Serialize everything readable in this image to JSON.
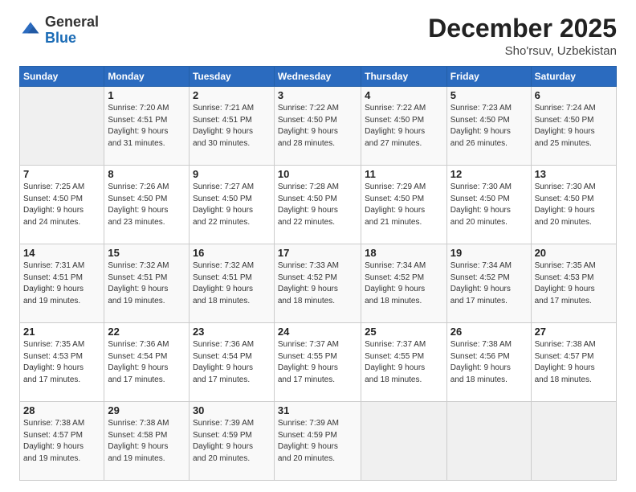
{
  "logo": {
    "general": "General",
    "blue": "Blue"
  },
  "header": {
    "month": "December 2025",
    "location": "Sho'rsuv, Uzbekistan"
  },
  "days_of_week": [
    "Sunday",
    "Monday",
    "Tuesday",
    "Wednesday",
    "Thursday",
    "Friday",
    "Saturday"
  ],
  "weeks": [
    [
      {
        "day": "",
        "sunrise": "",
        "sunset": "",
        "daylight": ""
      },
      {
        "day": "1",
        "sunrise": "Sunrise: 7:20 AM",
        "sunset": "Sunset: 4:51 PM",
        "daylight": "Daylight: 9 hours and 31 minutes."
      },
      {
        "day": "2",
        "sunrise": "Sunrise: 7:21 AM",
        "sunset": "Sunset: 4:51 PM",
        "daylight": "Daylight: 9 hours and 30 minutes."
      },
      {
        "day": "3",
        "sunrise": "Sunrise: 7:22 AM",
        "sunset": "Sunset: 4:50 PM",
        "daylight": "Daylight: 9 hours and 28 minutes."
      },
      {
        "day": "4",
        "sunrise": "Sunrise: 7:22 AM",
        "sunset": "Sunset: 4:50 PM",
        "daylight": "Daylight: 9 hours and 27 minutes."
      },
      {
        "day": "5",
        "sunrise": "Sunrise: 7:23 AM",
        "sunset": "Sunset: 4:50 PM",
        "daylight": "Daylight: 9 hours and 26 minutes."
      },
      {
        "day": "6",
        "sunrise": "Sunrise: 7:24 AM",
        "sunset": "Sunset: 4:50 PM",
        "daylight": "Daylight: 9 hours and 25 minutes."
      }
    ],
    [
      {
        "day": "7",
        "sunrise": "Sunrise: 7:25 AM",
        "sunset": "Sunset: 4:50 PM",
        "daylight": "Daylight: 9 hours and 24 minutes."
      },
      {
        "day": "8",
        "sunrise": "Sunrise: 7:26 AM",
        "sunset": "Sunset: 4:50 PM",
        "daylight": "Daylight: 9 hours and 23 minutes."
      },
      {
        "day": "9",
        "sunrise": "Sunrise: 7:27 AM",
        "sunset": "Sunset: 4:50 PM",
        "daylight": "Daylight: 9 hours and 22 minutes."
      },
      {
        "day": "10",
        "sunrise": "Sunrise: 7:28 AM",
        "sunset": "Sunset: 4:50 PM",
        "daylight": "Daylight: 9 hours and 22 minutes."
      },
      {
        "day": "11",
        "sunrise": "Sunrise: 7:29 AM",
        "sunset": "Sunset: 4:50 PM",
        "daylight": "Daylight: 9 hours and 21 minutes."
      },
      {
        "day": "12",
        "sunrise": "Sunrise: 7:30 AM",
        "sunset": "Sunset: 4:50 PM",
        "daylight": "Daylight: 9 hours and 20 minutes."
      },
      {
        "day": "13",
        "sunrise": "Sunrise: 7:30 AM",
        "sunset": "Sunset: 4:50 PM",
        "daylight": "Daylight: 9 hours and 20 minutes."
      }
    ],
    [
      {
        "day": "14",
        "sunrise": "Sunrise: 7:31 AM",
        "sunset": "Sunset: 4:51 PM",
        "daylight": "Daylight: 9 hours and 19 minutes."
      },
      {
        "day": "15",
        "sunrise": "Sunrise: 7:32 AM",
        "sunset": "Sunset: 4:51 PM",
        "daylight": "Daylight: 9 hours and 19 minutes."
      },
      {
        "day": "16",
        "sunrise": "Sunrise: 7:32 AM",
        "sunset": "Sunset: 4:51 PM",
        "daylight": "Daylight: 9 hours and 18 minutes."
      },
      {
        "day": "17",
        "sunrise": "Sunrise: 7:33 AM",
        "sunset": "Sunset: 4:52 PM",
        "daylight": "Daylight: 9 hours and 18 minutes."
      },
      {
        "day": "18",
        "sunrise": "Sunrise: 7:34 AM",
        "sunset": "Sunset: 4:52 PM",
        "daylight": "Daylight: 9 hours and 18 minutes."
      },
      {
        "day": "19",
        "sunrise": "Sunrise: 7:34 AM",
        "sunset": "Sunset: 4:52 PM",
        "daylight": "Daylight: 9 hours and 17 minutes."
      },
      {
        "day": "20",
        "sunrise": "Sunrise: 7:35 AM",
        "sunset": "Sunset: 4:53 PM",
        "daylight": "Daylight: 9 hours and 17 minutes."
      }
    ],
    [
      {
        "day": "21",
        "sunrise": "Sunrise: 7:35 AM",
        "sunset": "Sunset: 4:53 PM",
        "daylight": "Daylight: 9 hours and 17 minutes."
      },
      {
        "day": "22",
        "sunrise": "Sunrise: 7:36 AM",
        "sunset": "Sunset: 4:54 PM",
        "daylight": "Daylight: 9 hours and 17 minutes."
      },
      {
        "day": "23",
        "sunrise": "Sunrise: 7:36 AM",
        "sunset": "Sunset: 4:54 PM",
        "daylight": "Daylight: 9 hours and 17 minutes."
      },
      {
        "day": "24",
        "sunrise": "Sunrise: 7:37 AM",
        "sunset": "Sunset: 4:55 PM",
        "daylight": "Daylight: 9 hours and 17 minutes."
      },
      {
        "day": "25",
        "sunrise": "Sunrise: 7:37 AM",
        "sunset": "Sunset: 4:55 PM",
        "daylight": "Daylight: 9 hours and 18 minutes."
      },
      {
        "day": "26",
        "sunrise": "Sunrise: 7:38 AM",
        "sunset": "Sunset: 4:56 PM",
        "daylight": "Daylight: 9 hours and 18 minutes."
      },
      {
        "day": "27",
        "sunrise": "Sunrise: 7:38 AM",
        "sunset": "Sunset: 4:57 PM",
        "daylight": "Daylight: 9 hours and 18 minutes."
      }
    ],
    [
      {
        "day": "28",
        "sunrise": "Sunrise: 7:38 AM",
        "sunset": "Sunset: 4:57 PM",
        "daylight": "Daylight: 9 hours and 19 minutes."
      },
      {
        "day": "29",
        "sunrise": "Sunrise: 7:38 AM",
        "sunset": "Sunset: 4:58 PM",
        "daylight": "Daylight: 9 hours and 19 minutes."
      },
      {
        "day": "30",
        "sunrise": "Sunrise: 7:39 AM",
        "sunset": "Sunset: 4:59 PM",
        "daylight": "Daylight: 9 hours and 20 minutes."
      },
      {
        "day": "31",
        "sunrise": "Sunrise: 7:39 AM",
        "sunset": "Sunset: 4:59 PM",
        "daylight": "Daylight: 9 hours and 20 minutes."
      },
      {
        "day": "",
        "sunrise": "",
        "sunset": "",
        "daylight": ""
      },
      {
        "day": "",
        "sunrise": "",
        "sunset": "",
        "daylight": ""
      },
      {
        "day": "",
        "sunrise": "",
        "sunset": "",
        "daylight": ""
      }
    ]
  ]
}
